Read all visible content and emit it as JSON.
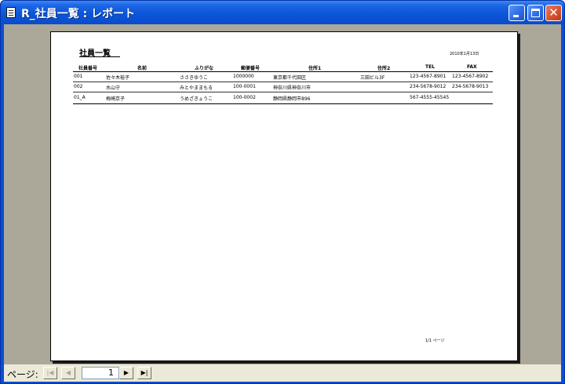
{
  "window": {
    "title": "R_社員一覧 : レポート"
  },
  "report": {
    "title": "社員一覧",
    "date": "2010年1月13日",
    "headers": [
      "社員番号",
      "名前",
      "ふりがな",
      "郵便番号",
      "住所1",
      "住所2",
      "TEL",
      "FAX"
    ],
    "rows": [
      [
        "001",
        "佐々木裕子",
        "ささきゆうこ",
        "1000000",
        "東京都千代田区",
        "三田ビル3F",
        "123-4567-8901",
        "123-4567-8902"
      ],
      [
        "002",
        "水山守",
        "みとやままもる",
        "100-0001",
        "神奈川県神奈川市",
        "",
        "234-5678-9012",
        "234-5678-9013"
      ],
      [
        "01_A",
        "梅崎京子",
        "うめざきょうこ",
        "100-0002",
        "静岡県静岡市896",
        "",
        "567-4555-45545",
        ""
      ]
    ],
    "page_text": "1/1 ページ"
  },
  "nav": {
    "page_label": "ページ:",
    "current_page": "1",
    "first_glyph": "|◀",
    "prev_glyph": "◀",
    "next_glyph": "▶",
    "last_glyph": "▶|"
  },
  "controls": {
    "minimize_glyph": "_",
    "maximize_glyph": "□",
    "close_glyph": "✕"
  }
}
